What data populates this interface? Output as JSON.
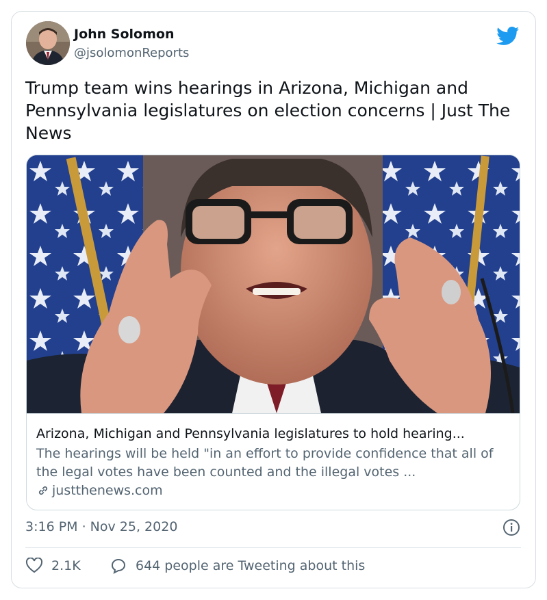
{
  "tweet": {
    "author_name": "John Solomon",
    "author_handle": "@jsolomonReports",
    "text": "Trump team wins hearings in Arizona, Michigan and Pennsylvania legislatures on election concerns | Just The News",
    "timestamp": "3:16 PM · Nov 25, 2020"
  },
  "link_card": {
    "title": "Arizona, Michigan and Pennsylvania legislatures to hold hearing...",
    "description": "The hearings will be held \"in an effort to provide confidence that all of the legal votes have been counted and the illegal votes ...",
    "domain": "justthenews.com"
  },
  "actions": {
    "like_count": "2.1K",
    "tweeting_about": "644 people are Tweeting about this"
  },
  "icons": {
    "brand": "twitter-bird-icon",
    "info": "info-icon",
    "link": "link-icon",
    "like": "heart-icon",
    "reply": "speech-bubble-icon"
  },
  "colors": {
    "twitter_blue": "#1d9bf0",
    "primary_text": "#0f1419",
    "secondary_text": "#536471",
    "border": "#cfd9de"
  }
}
